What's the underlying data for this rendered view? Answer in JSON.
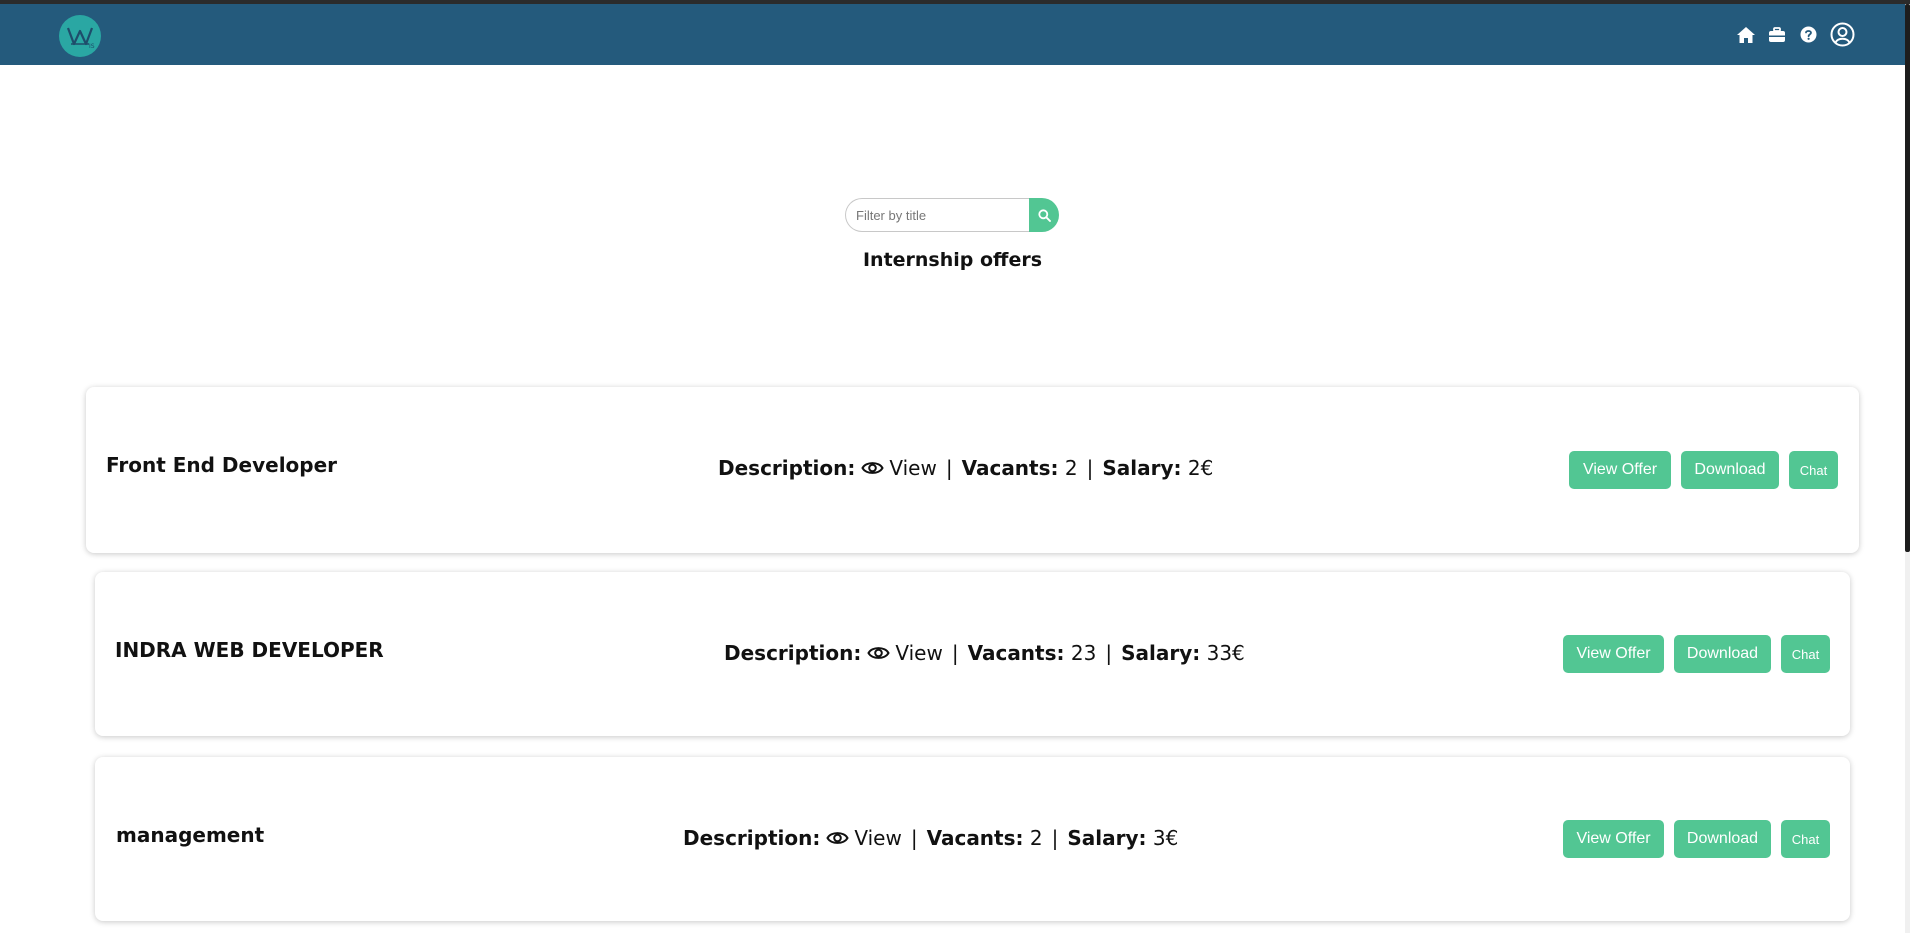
{
  "header": {
    "logo_icon": "wl-logo",
    "icons": [
      "home-icon",
      "briefcase-icon",
      "help-icon",
      "user-icon"
    ]
  },
  "search": {
    "placeholder": "Filter by title"
  },
  "page_title": "Internship offers",
  "labels": {
    "description": "Description:",
    "view": "View",
    "vacants": "Vacants:",
    "salary": "Salary:",
    "separator": "|",
    "view_offer": "View Offer",
    "download": "Download",
    "chat": "Chat"
  },
  "offers": [
    {
      "title": "Front End Developer",
      "vacants": "2",
      "salary": "2€"
    },
    {
      "title": "INDRA WEB DEVELOPER",
      "vacants": "23",
      "salary": "33€"
    },
    {
      "title": "management",
      "vacants": "2",
      "salary": "3€"
    }
  ],
  "colors": {
    "navbar": "#245a7c",
    "accent": "#52c693",
    "logo": "#2aa7a3"
  }
}
